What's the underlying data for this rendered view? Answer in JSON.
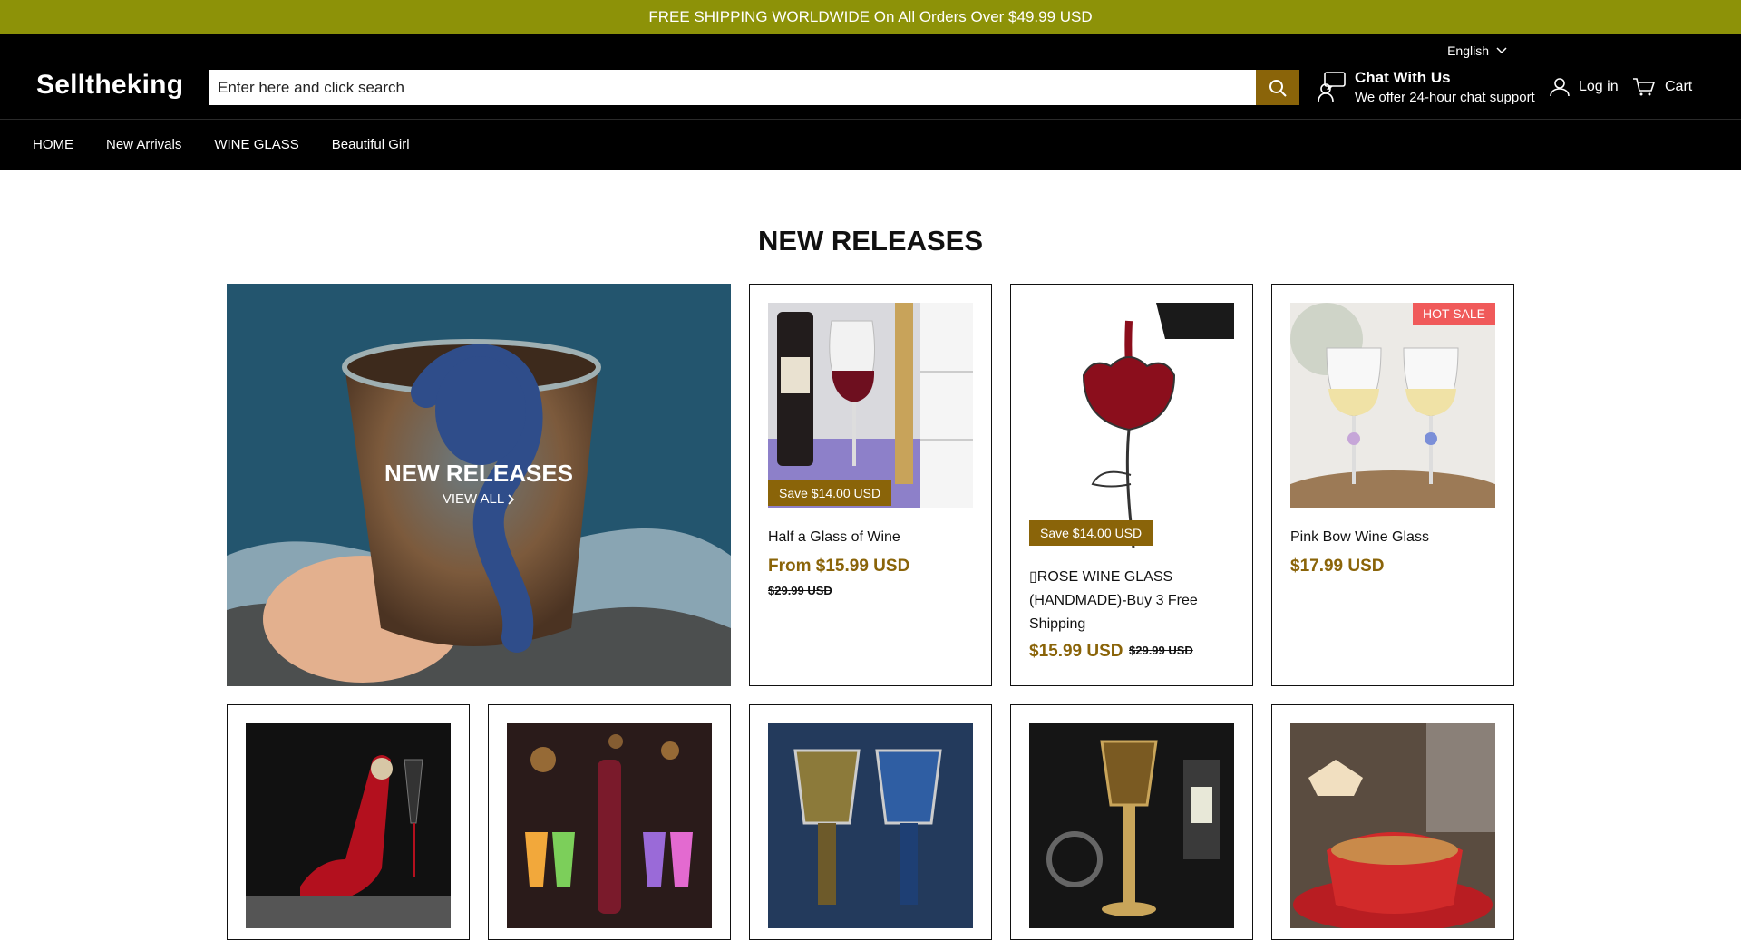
{
  "announcement": "FREE SHIPPING WORLDWIDE On All Orders Over $49.99 USD",
  "header": {
    "language": "English",
    "logo": "Selltheking",
    "search_placeholder": "Enter here and click search",
    "chat_title": "Chat With Us",
    "chat_subtitle": "We offer 24-hour chat support",
    "login": "Log in",
    "cart": "Cart"
  },
  "nav": [
    "HOME",
    "New Arrivals",
    "WINE GLASS",
    "Beautiful Girl"
  ],
  "section_title": "NEW RELEASES",
  "hero": {
    "title": "NEW RELEASES",
    "link": "VIEW ALL"
  },
  "products": [
    {
      "title": "Half a Glass of Wine",
      "price": "From $15.99 USD",
      "compare": "$29.99 USD",
      "badge": "Save $14.00 USD"
    },
    {
      "title": "▯ROSE WINE GLASS (HANDMADE)-Buy 3 Free Shipping",
      "price": "$15.99 USD",
      "compare": "$29.99 USD",
      "badge": "Save $14.00 USD"
    },
    {
      "title": "Pink Bow Wine Glass",
      "price": "$17.99 USD",
      "badge": "HOT SALE"
    }
  ],
  "colors": {
    "announcement_bg": "#8d9208",
    "accent": "#8a6409",
    "hot_badge": "#f05a5a"
  }
}
